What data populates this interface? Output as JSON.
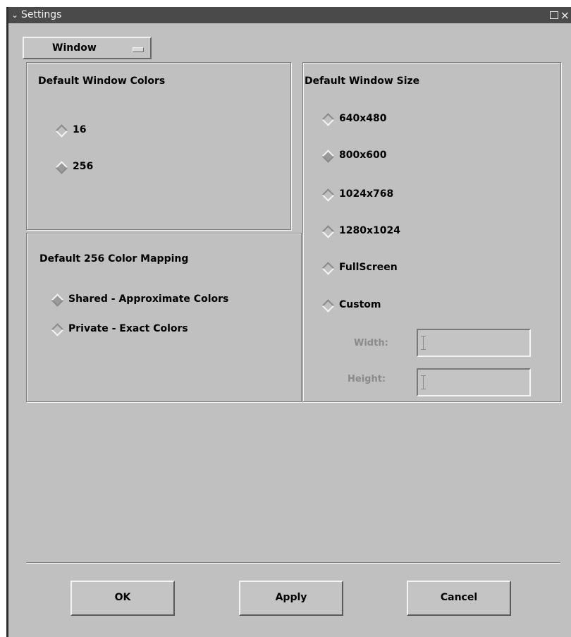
{
  "window": {
    "title": "Settings"
  },
  "category": {
    "selected": "Window"
  },
  "colors": {
    "title": "Default Window Colors",
    "options": [
      {
        "label": "16",
        "selected": false
      },
      {
        "label": "256",
        "selected": true
      }
    ]
  },
  "mapping": {
    "title": "Default 256 Color Mapping",
    "options": [
      {
        "label": "Shared - Approximate Colors",
        "selected": true
      },
      {
        "label": "Private - Exact Colors",
        "selected": false
      }
    ]
  },
  "size": {
    "title": "Default Window Size",
    "options": [
      {
        "label": "640x480",
        "selected": false
      },
      {
        "label": "800x600",
        "selected": true
      },
      {
        "label": "1024x768",
        "selected": false
      },
      {
        "label": "1280x1024",
        "selected": false
      },
      {
        "label": "FullScreen",
        "selected": false
      },
      {
        "label": "Custom",
        "selected": false
      }
    ],
    "width_label": "Width:",
    "height_label": "Height:",
    "width_value": "",
    "height_value": ""
  },
  "buttons": {
    "ok": "OK",
    "apply": "Apply",
    "cancel": "Cancel"
  }
}
